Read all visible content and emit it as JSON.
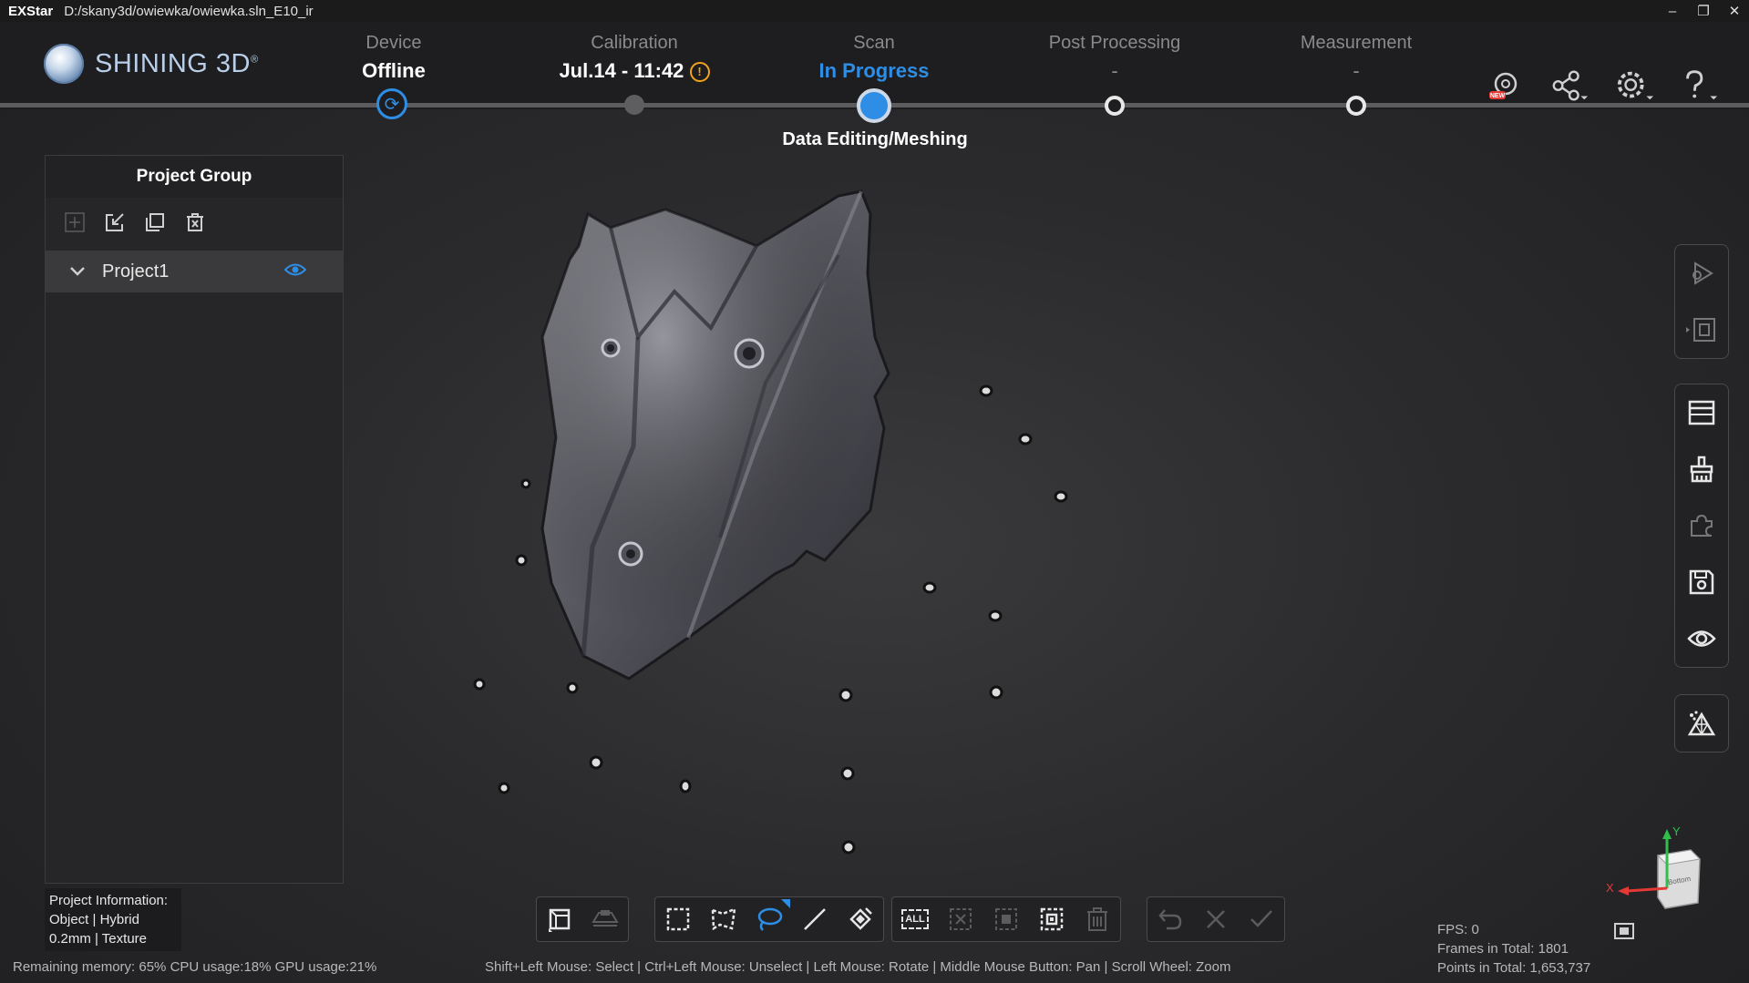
{
  "titlebar": {
    "app_name": "EXStar",
    "path": "D:/skany3d/owiewka/owiewka.sln_E10_ir",
    "minimize": "–",
    "restore": "❐",
    "close": "✕"
  },
  "brand": {
    "logo_text": "SHINING 3D",
    "trademark": "®"
  },
  "workflow": {
    "device": {
      "label": "Device",
      "value": "Offline"
    },
    "calibration": {
      "label": "Calibration",
      "value": "Jul.14 - 11:42",
      "warning": "!"
    },
    "scan": {
      "label": "Scan",
      "value": "In Progress",
      "substep": "Data Editing/Meshing"
    },
    "post_processing": {
      "label": "Post Processing",
      "value": "-"
    },
    "measurement": {
      "label": "Measurement",
      "value": "-"
    }
  },
  "header_icons": [
    "scanner-new-icon",
    "share-icon",
    "settings-icon",
    "help-icon"
  ],
  "project_panel": {
    "title": "Project Group",
    "tools": [
      "add-icon",
      "import-icon",
      "duplicate-icon",
      "delete-icon"
    ],
    "projects": [
      {
        "name": "Project1",
        "visible": true,
        "expanded": true
      }
    ]
  },
  "project_info": {
    "heading": "Project Information:",
    "line1": "Object | Hybrid",
    "line2": "0.2mm | Texture"
  },
  "right_toolbar": {
    "group1": [
      "play-scan-icon",
      "frame-icon"
    ],
    "group2": [
      "window-icon",
      "cleanup-icon",
      "puzzle-icon",
      "save-icon",
      "eye-icon"
    ],
    "group3": [
      "mesh-icon"
    ]
  },
  "bottom_toolbar": {
    "group1": [
      "view-cube-icon",
      "plane-icon"
    ],
    "group2": [
      "rect-select-icon",
      "polygon-select-icon",
      "lasso-select-icon",
      "line-select-icon",
      "brush-select-icon"
    ],
    "group3": {
      "all_label": "ALL",
      "icons": [
        "select-all-icon",
        "unselect-icon",
        "invert-select-icon",
        "select-connected-icon",
        "delete-selected-icon"
      ]
    },
    "group4": [
      "undo-icon",
      "cancel-icon",
      "confirm-icon"
    ]
  },
  "status": {
    "resources": "Remaining memory: 65% CPU usage:18%  GPU usage:21%",
    "hint": "Shift+Left Mouse: Select | Ctrl+Left Mouse: Unselect | Left Mouse: Rotate | Middle Mouse Button: Pan | Scroll Wheel: Zoom"
  },
  "stats": {
    "fps": "FPS: 0",
    "frames": "Frames in Total: 1801",
    "points": "Points in Total: 1,653,737"
  },
  "axis": {
    "x_label": "X",
    "y_label": "Y",
    "cube_face": "Bottom"
  },
  "colors": {
    "accent": "#2e8ee6",
    "warning": "#f0a21b",
    "background": "#2b2b2d"
  }
}
